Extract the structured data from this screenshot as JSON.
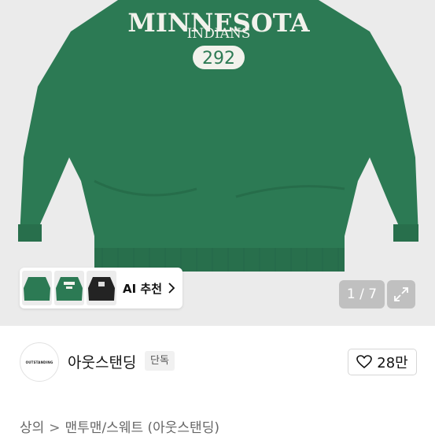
{
  "product": {
    "print": {
      "arc_text": "MINNESOTA",
      "sub_text": "INDIANS",
      "number": "292"
    },
    "sweatshirt_color": "#2c7a54"
  },
  "thumbnails": {
    "ai_label": "AI 추천",
    "items": [
      {
        "color": "#2c7a54"
      },
      {
        "color": "#2c7a54"
      },
      {
        "color": "#232323"
      }
    ]
  },
  "gallery": {
    "counter": "1 / 7"
  },
  "brand": {
    "logo_text": "OUTSTANDING",
    "name": "아웃스탠딩",
    "badge": "단독",
    "like_count": "28만"
  },
  "breadcrumb": {
    "items": [
      "상의",
      "맨투맨/스웨트 (아웃스탠딩)"
    ]
  },
  "colors": {
    "hero_bg": "#ebebeb",
    "sweatshirt": "#2c7a54",
    "print": "#f2f2ec"
  }
}
